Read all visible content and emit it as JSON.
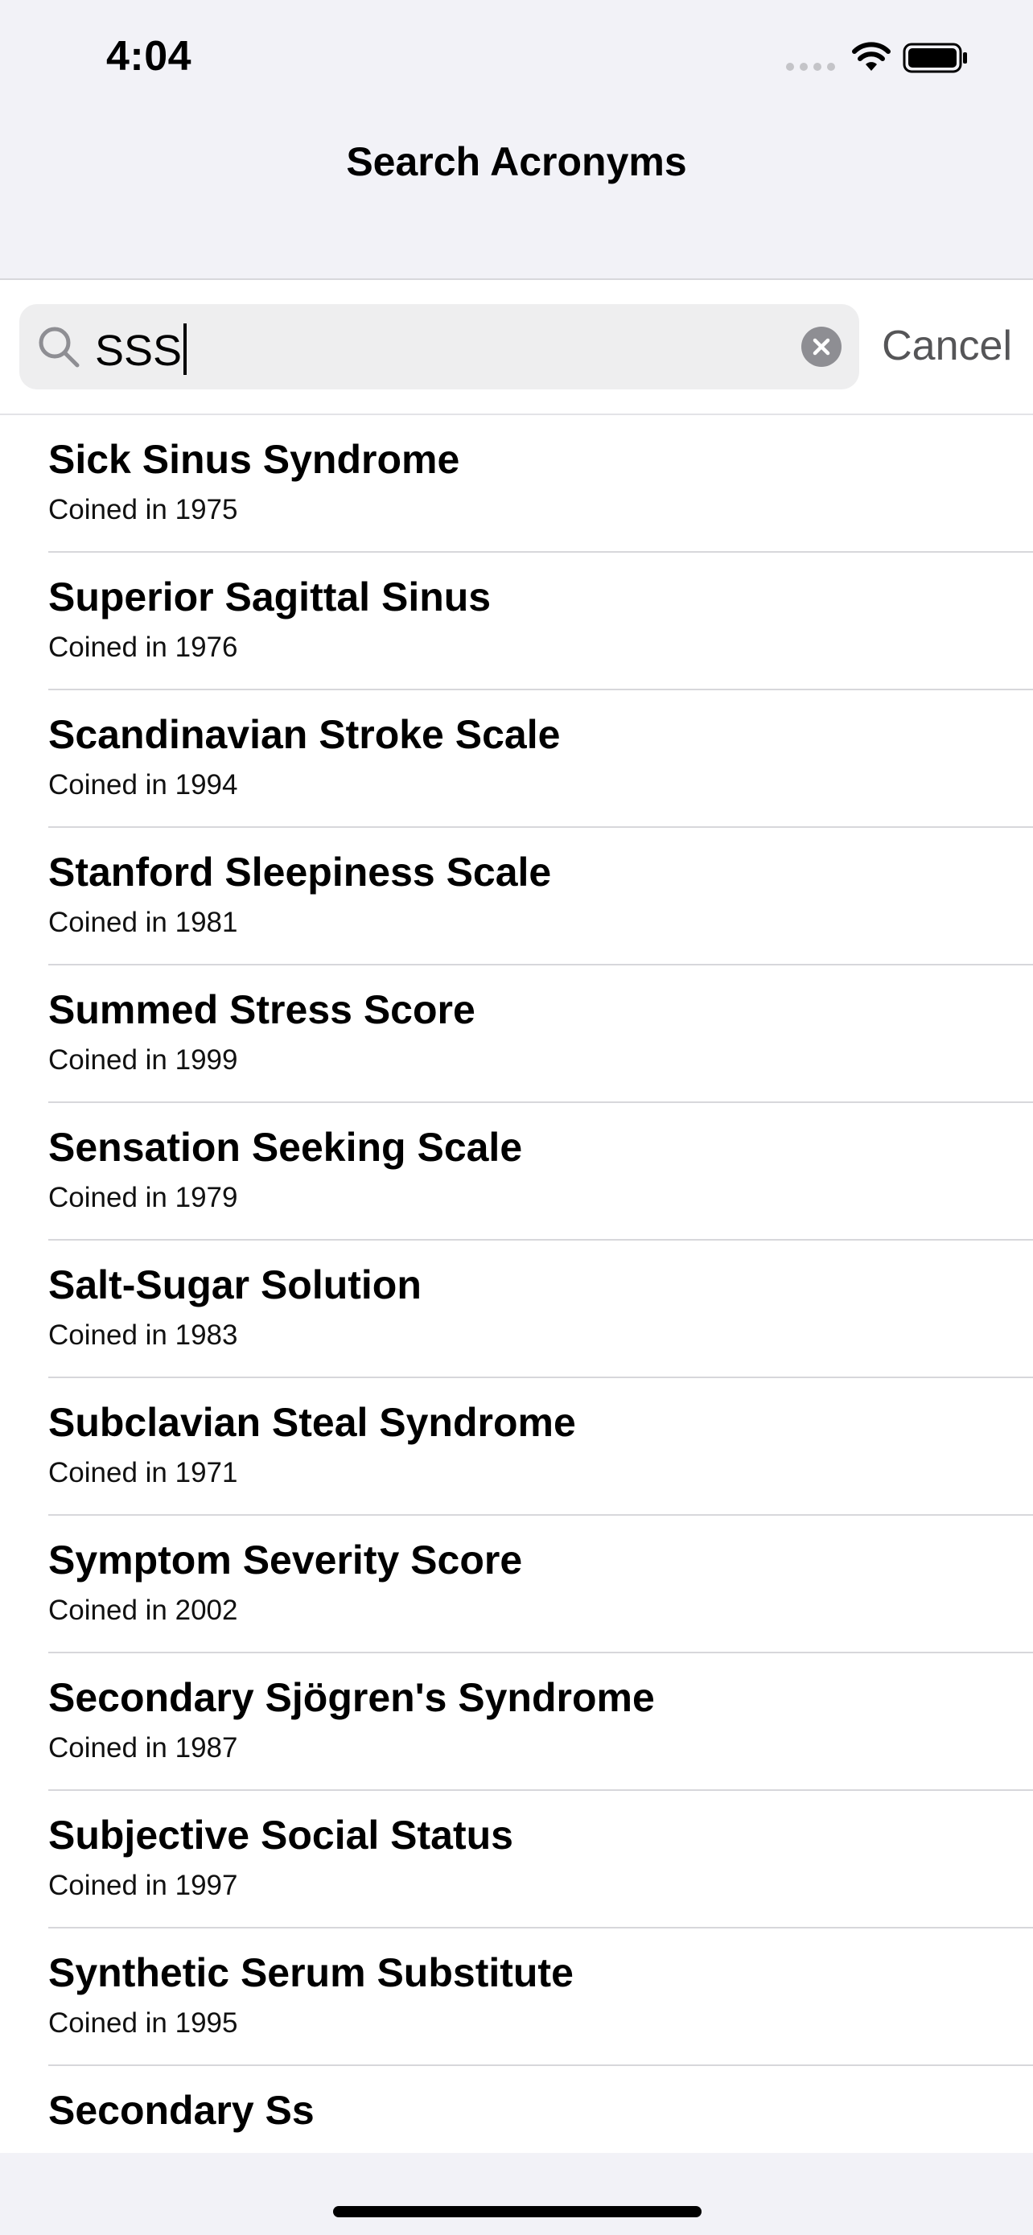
{
  "status_bar": {
    "time": "4:04"
  },
  "nav": {
    "title": "Search Acronyms"
  },
  "search": {
    "value": "SSS",
    "cancel_label": "Cancel"
  },
  "results": [
    {
      "title": "Sick Sinus Syndrome",
      "subtitle": "Coined in 1975"
    },
    {
      "title": "Superior Sagittal Sinus",
      "subtitle": "Coined in 1976"
    },
    {
      "title": "Scandinavian Stroke Scale",
      "subtitle": "Coined in 1994"
    },
    {
      "title": "Stanford Sleepiness Scale",
      "subtitle": "Coined in 1981"
    },
    {
      "title": "Summed Stress Score",
      "subtitle": "Coined in 1999"
    },
    {
      "title": "Sensation Seeking Scale",
      "subtitle": "Coined in 1979"
    },
    {
      "title": "Salt-Sugar Solution",
      "subtitle": "Coined in 1983"
    },
    {
      "title": "Subclavian Steal Syndrome",
      "subtitle": "Coined in 1971"
    },
    {
      "title": "Symptom Severity Score",
      "subtitle": "Coined in 2002"
    },
    {
      "title": "Secondary Sjögren's Syndrome",
      "subtitle": "Coined in 1987"
    },
    {
      "title": "Subjective Social Status",
      "subtitle": "Coined in 1997"
    },
    {
      "title": "Synthetic Serum Substitute",
      "subtitle": "Coined in 1995"
    },
    {
      "title": "Secondary Ss",
      "subtitle": ""
    }
  ],
  "icons": {
    "signal": "signal-icon",
    "wifi": "wifi-icon",
    "battery": "battery-icon",
    "search": "search-icon",
    "clear": "clear-text-icon"
  },
  "colors": {
    "background": "#f2f2f7",
    "list_background": "#ffffff",
    "search_field": "#eeeeef",
    "cancel_text": "#555557",
    "clear_button": "#8e8e93"
  }
}
